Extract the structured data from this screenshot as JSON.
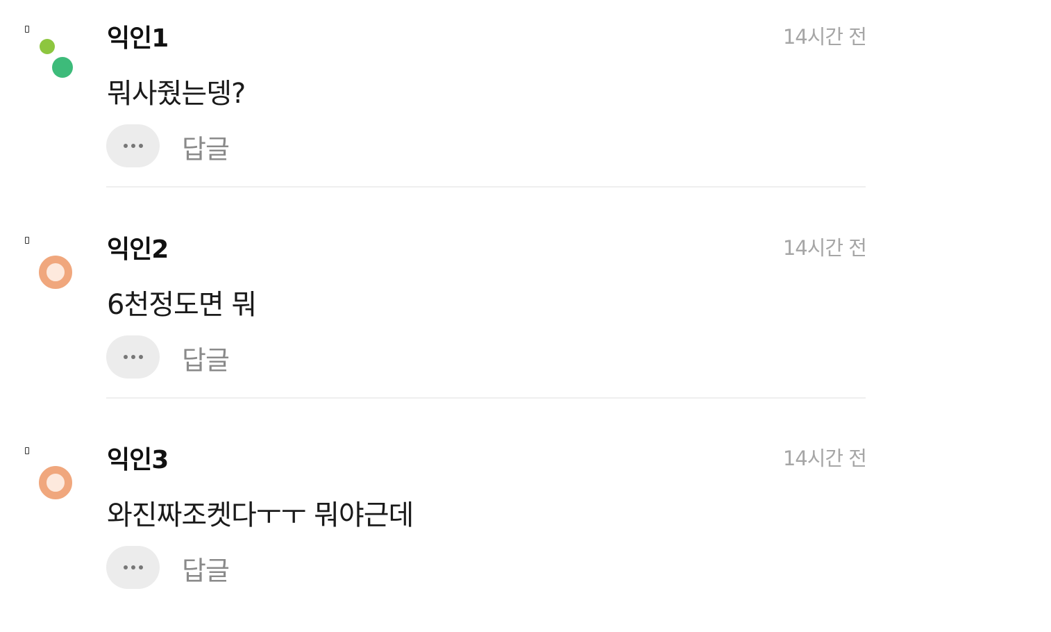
{
  "comments": [
    {
      "author": "익인1",
      "time": "14시간 전",
      "text": "뭐사줬는뎅?",
      "reply_label": "답글",
      "avatar": {
        "style": "dots",
        "color_a": "#8dc63f",
        "color_b": "#3dbb7a"
      }
    },
    {
      "author": "익인2",
      "time": "14시간 전",
      "text": "6천정도면 뭐",
      "reply_label": "답글",
      "avatar": {
        "style": "ring",
        "color": "#f0a77d"
      }
    },
    {
      "author": "익인3",
      "time": "14시간 전",
      "text": "와진짜조켓다ㅜㅜ 뭐야근데",
      "reply_label": "답글",
      "avatar": {
        "style": "ring",
        "color": "#f0a77d"
      }
    }
  ],
  "icons": {
    "more": "more-horizontal-icon",
    "marker": "small-square-icon"
  }
}
